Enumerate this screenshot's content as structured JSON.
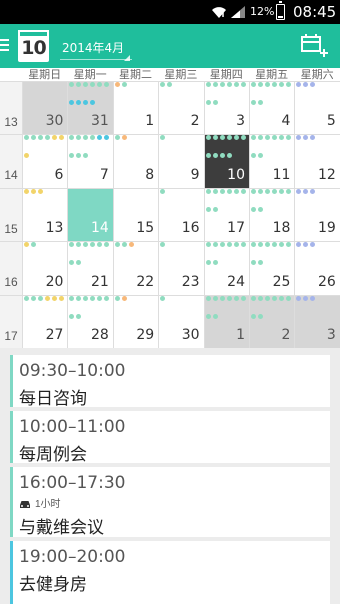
{
  "status_bar": {
    "battery_percent": "12%",
    "time": "08:45"
  },
  "app_bar": {
    "today_badge": "10",
    "month_title": "2014年4月"
  },
  "calendar": {
    "weekday_headers": [
      "星期日",
      "星期一",
      "星期二",
      "星期三",
      "星期四",
      "星期五",
      "星期六"
    ],
    "weeks": [
      {
        "week_number": "13",
        "days": [
          {
            "day": "30",
            "state": "outside",
            "dots": []
          },
          {
            "day": "31",
            "state": "outside",
            "dots": [
              "#90dcc0",
              "#90dcc0",
              "#90dcc0",
              "#90dcc0",
              "#90dcc0",
              "#90dcc0",
              "#4cc6e0",
              "#4cc6e0",
              "#4cc6e0",
              "#4cc6e0"
            ]
          },
          {
            "day": "1",
            "state": "normal",
            "dots": [
              "#f7b87a",
              "#90dcc0"
            ]
          },
          {
            "day": "2",
            "state": "normal",
            "dots": [
              "#90dcc0",
              "#90dcc0"
            ]
          },
          {
            "day": "3",
            "state": "normal",
            "dots": [
              "#90dcc0",
              "#90dcc0",
              "#90dcc0",
              "#90dcc0",
              "#90dcc0",
              "#90dcc0",
              "#90dcc0",
              "#90dcc0"
            ]
          },
          {
            "day": "4",
            "state": "normal",
            "dots": [
              "#90dcc0",
              "#90dcc0",
              "#90dcc0",
              "#90dcc0",
              "#90dcc0",
              "#90dcc0",
              "#90dcc0",
              "#90dcc0"
            ]
          },
          {
            "day": "5",
            "state": "normal",
            "dots": [
              "#a5b4ea",
              "#a5b4ea",
              "#a5b4ea"
            ]
          }
        ]
      },
      {
        "week_number": "14",
        "days": [
          {
            "day": "6",
            "state": "normal",
            "dots": [
              "#90dcc0",
              "#90dcc0",
              "#90dcc0",
              "#90dcc0",
              "#f2d46a",
              "#f2d46a",
              "#f2d46a"
            ]
          },
          {
            "day": "7",
            "state": "normal",
            "dots": [
              "#90dcc0",
              "#90dcc0",
              "#90dcc0",
              "#90dcc0",
              "#4cc6e0",
              "#4cc6e0",
              "#90dcc0",
              "#90dcc0",
              "#90dcc0"
            ]
          },
          {
            "day": "8",
            "state": "normal",
            "dots": [
              "#90dcc0",
              "#f7b87a"
            ]
          },
          {
            "day": "9",
            "state": "normal",
            "dots": [
              "#90dcc0"
            ]
          },
          {
            "day": "10",
            "state": "today",
            "dots": [
              "#90dcc0",
              "#90dcc0",
              "#90dcc0",
              "#90dcc0",
              "#90dcc0",
              "#90dcc0",
              "#90dcc0",
              "#90dcc0",
              "#90dcc0",
              "#90dcc0"
            ]
          },
          {
            "day": "11",
            "state": "normal",
            "dots": [
              "#90dcc0",
              "#90dcc0",
              "#90dcc0",
              "#90dcc0",
              "#90dcc0",
              "#90dcc0",
              "#90dcc0",
              "#90dcc0"
            ]
          },
          {
            "day": "12",
            "state": "normal",
            "dots": [
              "#a5b4ea",
              "#a5b4ea",
              "#a5b4ea"
            ]
          }
        ]
      },
      {
        "week_number": "15",
        "days": [
          {
            "day": "13",
            "state": "normal",
            "dots": [
              "#f2d46a",
              "#f2d46a",
              "#f2d46a"
            ]
          },
          {
            "day": "14",
            "state": "selected",
            "dots": []
          },
          {
            "day": "15",
            "state": "normal",
            "dots": []
          },
          {
            "day": "16",
            "state": "normal",
            "dots": [
              "#90dcc0"
            ]
          },
          {
            "day": "17",
            "state": "normal",
            "dots": [
              "#90dcc0",
              "#90dcc0",
              "#90dcc0",
              "#90dcc0",
              "#90dcc0",
              "#90dcc0",
              "#90dcc0",
              "#90dcc0"
            ]
          },
          {
            "day": "18",
            "state": "normal",
            "dots": [
              "#90dcc0",
              "#90dcc0",
              "#90dcc0",
              "#90dcc0",
              "#90dcc0",
              "#90dcc0",
              "#90dcc0",
              "#90dcc0"
            ]
          },
          {
            "day": "19",
            "state": "normal",
            "dots": [
              "#a5b4ea",
              "#a5b4ea",
              "#a5b4ea"
            ]
          }
        ]
      },
      {
        "week_number": "16",
        "days": [
          {
            "day": "20",
            "state": "normal",
            "dots": [
              "#f2d46a",
              "#90dcc0"
            ]
          },
          {
            "day": "21",
            "state": "normal",
            "dots": [
              "#90dcc0",
              "#90dcc0",
              "#90dcc0",
              "#90dcc0",
              "#90dcc0",
              "#90dcc0",
              "#90dcc0",
              "#90dcc0"
            ]
          },
          {
            "day": "22",
            "state": "normal",
            "dots": [
              "#90dcc0",
              "#90dcc0",
              "#f7b87a"
            ]
          },
          {
            "day": "23",
            "state": "normal",
            "dots": [
              "#90dcc0"
            ]
          },
          {
            "day": "24",
            "state": "normal",
            "dots": [
              "#90dcc0",
              "#90dcc0",
              "#90dcc0",
              "#90dcc0",
              "#90dcc0",
              "#90dcc0",
              "#90dcc0",
              "#90dcc0"
            ]
          },
          {
            "day": "25",
            "state": "normal",
            "dots": [
              "#90dcc0",
              "#90dcc0",
              "#90dcc0",
              "#90dcc0",
              "#90dcc0",
              "#90dcc0",
              "#90dcc0",
              "#90dcc0"
            ]
          },
          {
            "day": "26",
            "state": "normal",
            "dots": [
              "#a5b4ea",
              "#a5b4ea",
              "#a5b4ea"
            ]
          }
        ]
      },
      {
        "week_number": "17",
        "days": [
          {
            "day": "27",
            "state": "normal",
            "dots": [
              "#90dcc0",
              "#90dcc0",
              "#90dcc0",
              "#f2d46a",
              "#f2d46a",
              "#f2d46a"
            ]
          },
          {
            "day": "28",
            "state": "normal",
            "dots": [
              "#90dcc0",
              "#90dcc0",
              "#90dcc0",
              "#90dcc0",
              "#90dcc0",
              "#90dcc0",
              "#90dcc0",
              "#90dcc0"
            ]
          },
          {
            "day": "29",
            "state": "normal",
            "dots": [
              "#90dcc0",
              "#f7b87a"
            ]
          },
          {
            "day": "30",
            "state": "normal",
            "dots": [
              "#90dcc0"
            ]
          },
          {
            "day": "1",
            "state": "outside",
            "dots": [
              "#90dcc0",
              "#90dcc0",
              "#90dcc0",
              "#90dcc0",
              "#90dcc0",
              "#90dcc0",
              "#90dcc0",
              "#90dcc0"
            ]
          },
          {
            "day": "2",
            "state": "outside",
            "dots": [
              "#90dcc0",
              "#90dcc0",
              "#90dcc0",
              "#90dcc0",
              "#90dcc0",
              "#90dcc0",
              "#90dcc0",
              "#90dcc0"
            ]
          },
          {
            "day": "3",
            "state": "outside",
            "dots": [
              "#a5b4ea",
              "#a5b4ea",
              "#a5b4ea"
            ]
          }
        ]
      }
    ]
  },
  "agenda": {
    "events": [
      {
        "time": "09:30–10:00",
        "title": "每日咨询",
        "meta": ""
      },
      {
        "time": "10:00–11:00",
        "title": "每周例会",
        "meta": ""
      },
      {
        "time": "16:00–17:30",
        "title": "与戴维会议",
        "meta": "1小时"
      },
      {
        "time": "19:00–20:00",
        "title": "去健身房",
        "meta": ""
      }
    ]
  },
  "colors": {
    "primary": "#1fbe9c",
    "today": "#3d3d3d",
    "selected": "#7fd8c4",
    "outside": "#d6d6d6",
    "gym_accent": "#4cc6e0"
  }
}
